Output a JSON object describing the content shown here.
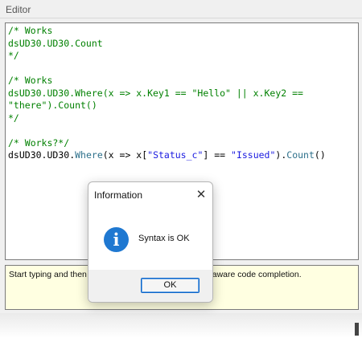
{
  "editor": {
    "title": "Editor",
    "code_lines": [
      [
        {
          "t": "/* Works",
          "c": "comment"
        }
      ],
      [
        {
          "t": "dsUD30.UD30.Count",
          "c": "comment"
        }
      ],
      [
        {
          "t": "*/",
          "c": "comment"
        }
      ],
      [],
      [
        {
          "t": "/* Works",
          "c": "comment"
        }
      ],
      [
        {
          "t": "dsUD30.UD30.Where(x => x.Key1 == \"Hello\" || x.Key2 ==",
          "c": "comment"
        }
      ],
      [
        {
          "t": "\"there\").Count()",
          "c": "comment"
        }
      ],
      [
        {
          "t": "*/",
          "c": "comment"
        }
      ],
      [],
      [
        {
          "t": "/* Works?*/",
          "c": "comment"
        }
      ],
      [
        {
          "t": "dsUD30",
          "c": "default"
        },
        {
          "t": ".",
          "c": "default"
        },
        {
          "t": "UD30",
          "c": "default"
        },
        {
          "t": ".",
          "c": "default"
        },
        {
          "t": "Where",
          "c": "ident"
        },
        {
          "t": "(x => x[",
          "c": "default"
        },
        {
          "t": "\"Status_c\"",
          "c": "string"
        },
        {
          "t": "] == ",
          "c": "default"
        },
        {
          "t": "\"Issued\"",
          "c": "string"
        },
        {
          "t": ").",
          "c": "default"
        },
        {
          "t": "Count",
          "c": "ident"
        },
        {
          "t": "()",
          "c": "default"
        }
      ]
    ],
    "hint": {
      "visible_before_dialog": "Start typing and then",
      "visible_after_dialog": "aware code completion."
    }
  },
  "dialog": {
    "title": "Information",
    "close_icon": "close-icon",
    "icon": "info-icon",
    "message": "Syntax is OK",
    "ok_label": "OK"
  },
  "colors": {
    "comment": "#008000",
    "string": "#1a1ae0",
    "identifier": "#2b6f8a",
    "hint_background": "#ffffe1",
    "info_blue": "#1f78d1",
    "button_border": "#0a64c8"
  }
}
